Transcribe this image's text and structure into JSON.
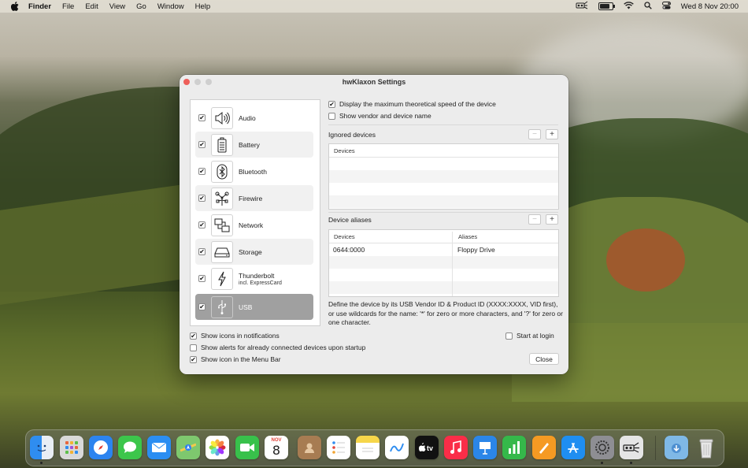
{
  "menubar": {
    "apple": "",
    "app": "Finder",
    "items": [
      "File",
      "Edit",
      "View",
      "Go",
      "Window",
      "Help"
    ],
    "clock": "Wed 8 Nov  20:00",
    "icons": [
      "hwklaxon-icon",
      "battery-icon",
      "wifi-icon",
      "search-icon",
      "control-center-icon"
    ]
  },
  "window": {
    "title": "hwKlaxon Settings",
    "categories": [
      {
        "label": "Audio",
        "checked": true,
        "icon": "speaker-icon"
      },
      {
        "label": "Battery",
        "checked": true,
        "icon": "battery-icon"
      },
      {
        "label": "Bluetooth",
        "checked": true,
        "icon": "bluetooth-icon"
      },
      {
        "label": "Firewire",
        "checked": true,
        "icon": "firewire-icon"
      },
      {
        "label": "Network",
        "checked": true,
        "icon": "network-icon"
      },
      {
        "label": "Storage",
        "checked": true,
        "icon": "storage-icon"
      },
      {
        "label": "Thunderbolt",
        "sublabel": "incl. ExpressCard",
        "checked": true,
        "icon": "thunderbolt-icon"
      },
      {
        "label": "USB",
        "checked": true,
        "icon": "usb-icon",
        "selected": true
      }
    ],
    "opt_speed": "Display the maximum theoretical speed of the device",
    "opt_vendor": "Show vendor and device name",
    "ignored_label": "Ignored devices",
    "ignored_header": "Devices",
    "aliases_label": "Device aliases",
    "aliases_headers": [
      "Devices",
      "Aliases"
    ],
    "alias_rows": [
      {
        "device": "0644:0000",
        "alias": "Floppy Drive"
      }
    ],
    "description": "Define the device by its USB Vendor ID & Product ID (XXXX:XXXX, VID first), or use wildcards for the name: '*' for zero or more characters, and '?' for zero or one character.",
    "opt_icons_notifications": "Show icons in notifications",
    "opt_alerts_startup": "Show alerts for already connected devices upon startup",
    "opt_menubar_icon": "Show icon in the Menu Bar",
    "opt_start_login": "Start at login",
    "close_label": "Close",
    "plus": "+",
    "minus": "−"
  },
  "dock": {
    "calendar_month": "NOV",
    "calendar_day": "8",
    "apps": [
      "Finder",
      "Launchpad",
      "Safari",
      "Messages",
      "Mail",
      "Maps",
      "Photos",
      "FaceTime",
      "Calendar",
      "Contacts",
      "Reminders",
      "Notes",
      "Freeform",
      "TV",
      "Music",
      "Keynote",
      "Numbers",
      "Pages",
      "App Store",
      "System Settings",
      "hwKlaxon",
      "Downloads",
      "Trash"
    ]
  }
}
